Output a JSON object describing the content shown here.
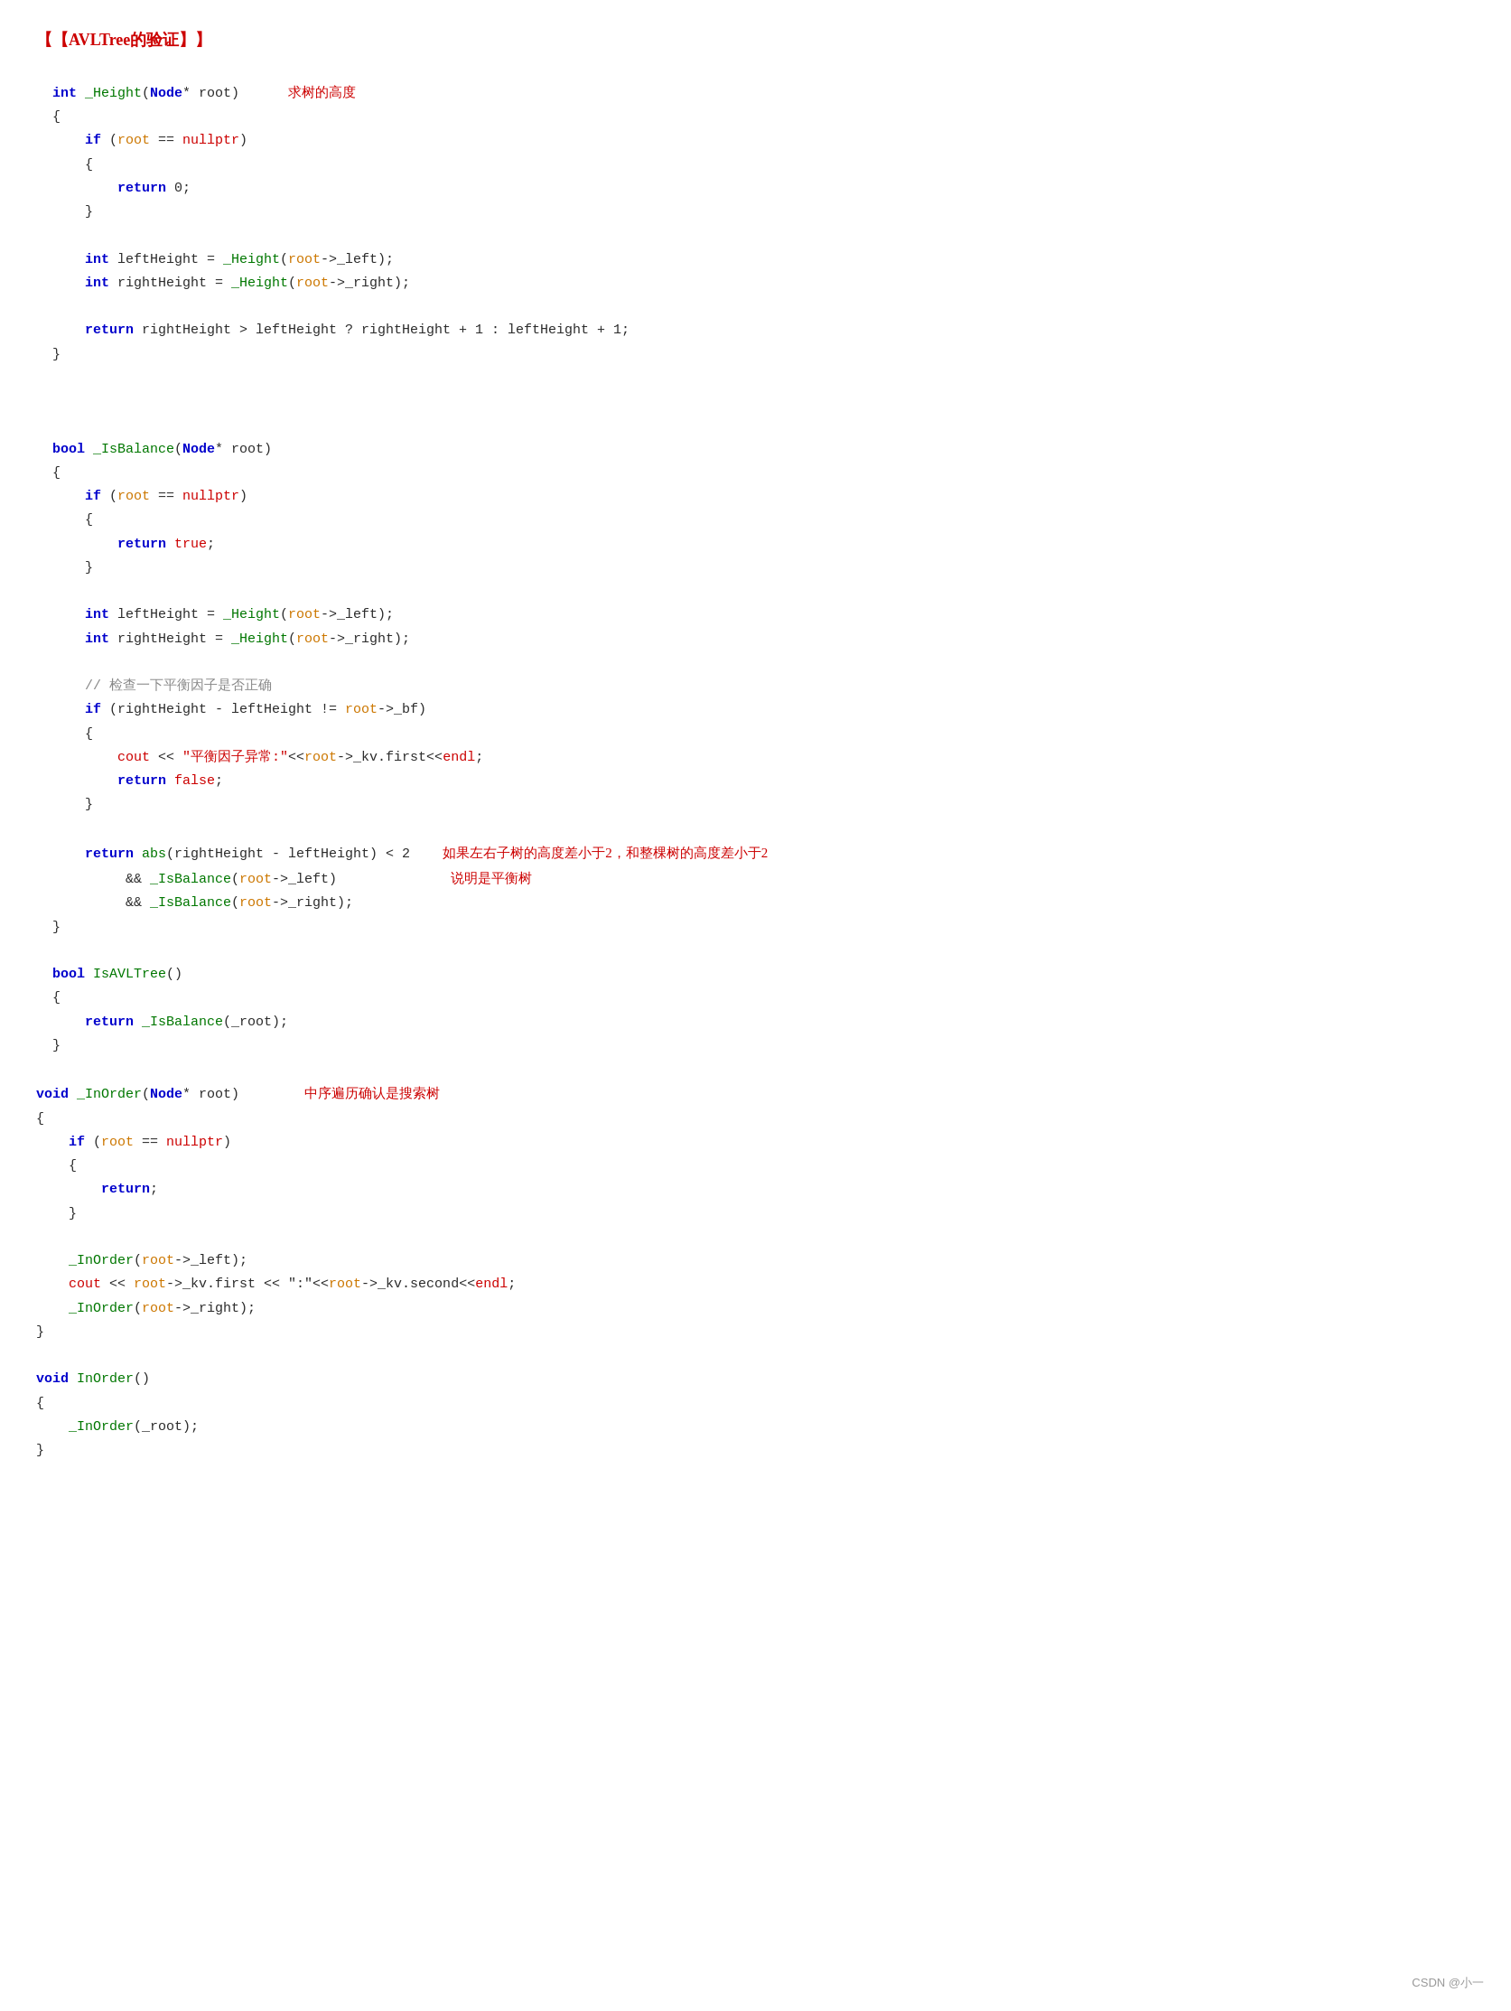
{
  "title": "【AVLTree的验证】",
  "watermark": "CSDN @小一",
  "sections": [
    {
      "name": "_Height",
      "comment": "求树的高度"
    },
    {
      "name": "_IsBalance",
      "comment1": "检查一下平衡因子是否正确",
      "comment2": "如果左右子树的高度差小于2，和整棵树的高度差小于2",
      "comment3": "说明是平衡树"
    },
    {
      "name": "_InOrder",
      "comment": "中序遍历确认是搜索树"
    }
  ]
}
